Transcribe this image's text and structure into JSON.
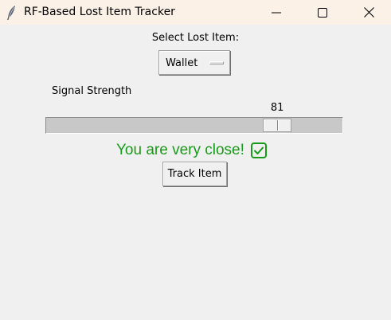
{
  "window": {
    "title": "RF-Based Lost Item Tracker",
    "app_icon": "feather-icon",
    "controls": [
      "minimize-icon",
      "maximize-icon",
      "close-icon"
    ]
  },
  "form": {
    "select_label": "Select Lost Item:",
    "selected_item": "Wallet",
    "signal_label": "Signal Strength",
    "signal": {
      "value": 81,
      "value_text": "81",
      "min": 0,
      "max": 100
    },
    "status_text": "You are very close!",
    "status_icon": "check-box-icon",
    "status_color": "#1a9a1a",
    "track_label": "Track Item"
  }
}
